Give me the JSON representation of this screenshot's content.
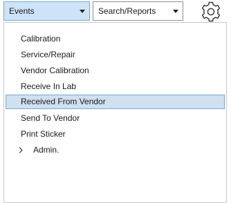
{
  "toolbar": {
    "events_dropdown": {
      "value": "Events",
      "open": true
    },
    "reports_dropdown": {
      "value": "Search/Reports"
    },
    "settings_icon": "gear-icon"
  },
  "menu": {
    "items": [
      {
        "label": "Calibration",
        "selected": false
      },
      {
        "label": "Service/Repair",
        "selected": false
      },
      {
        "label": "Vendor Calibration",
        "selected": false
      },
      {
        "label": "Receive In Lab",
        "selected": false
      },
      {
        "label": "Received From Vendor",
        "selected": true
      },
      {
        "label": "Send To Vendor",
        "selected": false
      },
      {
        "label": "Print Sticker",
        "selected": false
      },
      {
        "label": "Admin.",
        "selected": false,
        "has_submenu": true,
        "icon": "chevron-right-icon"
      }
    ]
  },
  "colors": {
    "selection_fill": "#cfe0f1",
    "selection_border": "#7aa6cf",
    "open_combo_fill": "#cde3f7"
  }
}
